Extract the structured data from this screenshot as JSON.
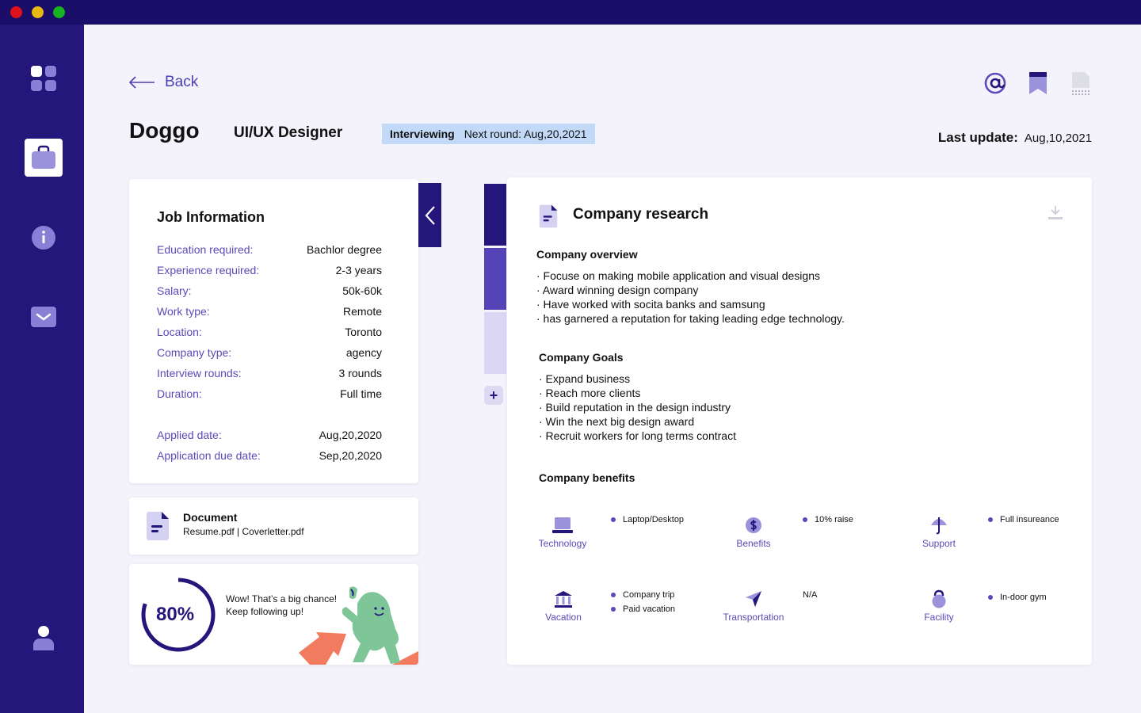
{
  "window": {
    "controls": [
      "close",
      "minimize",
      "maximize"
    ]
  },
  "sidebar": {
    "items": [
      {
        "name": "dashboard",
        "icon": "grid-icon",
        "active": false
      },
      {
        "name": "jobs",
        "icon": "briefcase-icon",
        "active": true
      },
      {
        "name": "info",
        "icon": "info-icon",
        "active": false
      },
      {
        "name": "inbox",
        "icon": "mail-icon",
        "active": false
      }
    ],
    "profile_icon": "user-icon"
  },
  "header": {
    "back_label": "Back",
    "candidate_name": "Doggo",
    "role": "UI/UX Designer",
    "status": "Interviewing",
    "next_round": "Next round: Aug,20,2021",
    "last_update_label": "Last update:",
    "last_update_value": "Aug,10,2021",
    "actions": [
      "at-sign-icon",
      "bookmark-icon",
      "document-icon"
    ]
  },
  "job_info": {
    "title": "Job Information",
    "rows": [
      {
        "label": "Education required:",
        "value": "Bachlor degree"
      },
      {
        "label": "Experience required:",
        "value": "2-3 years"
      },
      {
        "label": "Salary:",
        "value": "50k-60k"
      },
      {
        "label": "Work type:",
        "value": "Remote"
      },
      {
        "label": "Location:",
        "value": "Toronto"
      },
      {
        "label": "Company type:",
        "value": "agency"
      },
      {
        "label": "Interview rounds:",
        "value": "3 rounds"
      },
      {
        "label": "Duration:",
        "value": "Full time"
      }
    ],
    "dates": [
      {
        "label": "Applied date:",
        "value": "Aug,20,2020"
      },
      {
        "label": "Application due date:",
        "value": "Sep,20,2020"
      }
    ]
  },
  "document": {
    "title": "Document",
    "files": "Resume.pdf | Coverletter.pdf"
  },
  "progress": {
    "value_label": "80%",
    "fraction": 0.8,
    "message_line1": "Wow! That’s a big chance!",
    "message_line2": "Keep following up!"
  },
  "steps": {
    "colors": [
      "#24167a",
      "#5543b8",
      "#dad6f3"
    ],
    "add_label": "+"
  },
  "research": {
    "title": "Company research",
    "overview": {
      "heading": "Company overview",
      "items": [
        "· Focuse on making mobile application and visual designs",
        "· Award winning design company",
        "· Have worked with socita banks and samsung",
        "· has garnered a reputation for taking leading edge technology."
      ]
    },
    "goals": {
      "heading": "Company Goals",
      "items": [
        "· Expand business",
        "· Reach more clients",
        "· Build reputation in the design industry",
        "· Win the next big design award",
        "· Recruit workers for long terms contract"
      ]
    },
    "benefits": {
      "heading": "Company benefits",
      "items": [
        {
          "label": "Technology",
          "icon": "laptop-icon",
          "values": [
            "Laptop/Desktop"
          ]
        },
        {
          "label": "Benefits",
          "icon": "dollar-icon",
          "values": [
            "10%  raise"
          ]
        },
        {
          "label": "Support",
          "icon": "umbrella-icon",
          "values": [
            "Full insureance"
          ]
        },
        {
          "label": "Vacation",
          "icon": "bank-icon",
          "values": [
            "Company trip",
            "Paid vacation"
          ]
        },
        {
          "label": "Transportation",
          "icon": "navigation-icon",
          "values": [
            "N/A"
          ]
        },
        {
          "label": "Facility",
          "icon": "kettlebell-icon",
          "values": [
            "In-door gym"
          ]
        }
      ]
    }
  },
  "colors": {
    "primary": "#24167a",
    "accent": "#5a4ab8",
    "badge": "#c2daf7",
    "background": "#f4f3fb"
  }
}
